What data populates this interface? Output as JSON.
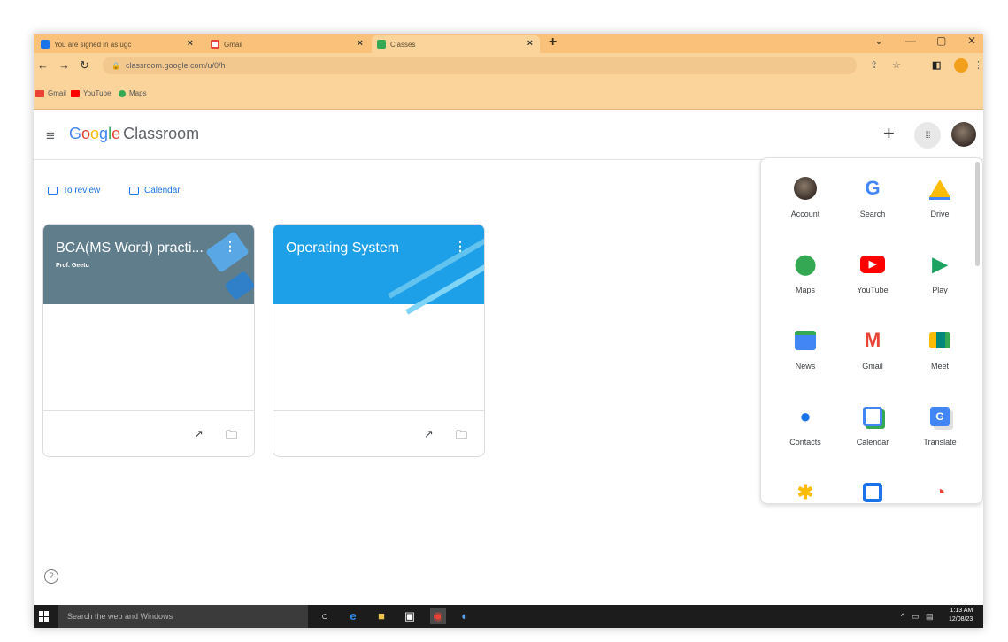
{
  "browser": {
    "tabs": [
      {
        "label": "You are signed in as ugc",
        "active": false,
        "favicon_color": "#1a73e8"
      },
      {
        "label": "Gmail",
        "active": false,
        "favicon_color": "#ea4335"
      },
      {
        "label": "Classes",
        "active": true,
        "favicon_color": "#34a853"
      }
    ],
    "url": "classroom.google.com/u/0/h",
    "bookmarks": [
      {
        "label": "Gmail",
        "color": "#ea4335"
      },
      {
        "label": "YouTube",
        "color": "#ff0000"
      },
      {
        "label": "Maps",
        "color": "#34a853"
      }
    ]
  },
  "header": {
    "logo_google": [
      "G",
      "o",
      "o",
      "g",
      "l",
      "e"
    ],
    "logo_product": "Classroom"
  },
  "quick_links": {
    "to_review": "To review",
    "calendar": "Calendar"
  },
  "classes": [
    {
      "title": "BCA(MS Word) practi...",
      "teacher": "Prof. Geetu",
      "color": "#607d8b"
    },
    {
      "title": "Operating System",
      "teacher": "",
      "color": "#1ea0e8"
    }
  ],
  "apps": [
    {
      "label": "Account",
      "icon": "account-icon"
    },
    {
      "label": "Search",
      "icon": "google-search-icon"
    },
    {
      "label": "Drive",
      "icon": "drive-icon"
    },
    {
      "label": "Maps",
      "icon": "maps-icon"
    },
    {
      "label": "YouTube",
      "icon": "youtube-icon"
    },
    {
      "label": "Play",
      "icon": "play-icon"
    },
    {
      "label": "News",
      "icon": "news-icon"
    },
    {
      "label": "Gmail",
      "icon": "gmail-icon"
    },
    {
      "label": "Meet",
      "icon": "meet-icon"
    },
    {
      "label": "Contacts",
      "icon": "contacts-icon"
    },
    {
      "label": "Calendar",
      "icon": "calendar-icon"
    },
    {
      "label": "Translate",
      "icon": "translate-icon"
    }
  ],
  "taskbar": {
    "search_placeholder": "Search the web and Windows",
    "time": "1:13 AM",
    "date": "12/08/23"
  },
  "colors": {
    "tab_bar": "#f9c17a",
    "link": "#1a73e8"
  }
}
